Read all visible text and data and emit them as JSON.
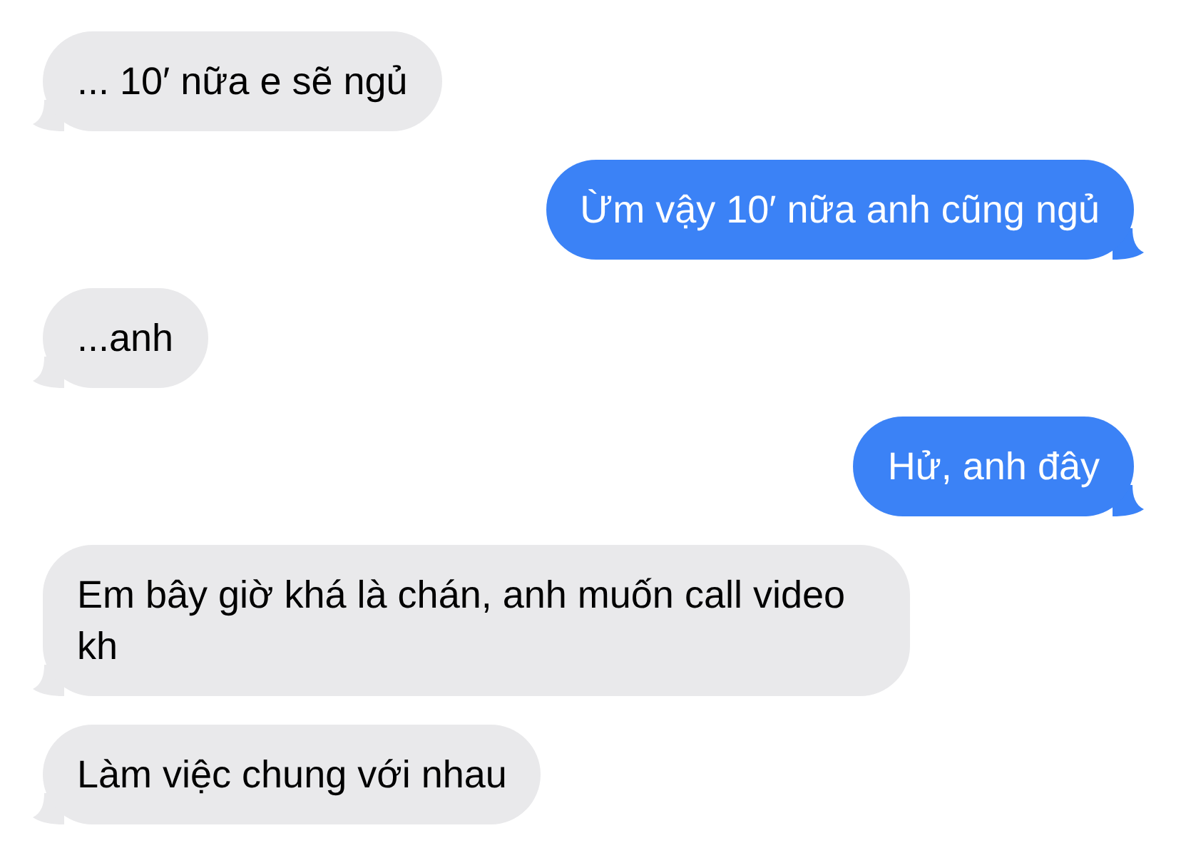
{
  "messages": [
    {
      "kind": "received",
      "text": "... 10′ nữa e sẽ ngủ"
    },
    {
      "kind": "sent",
      "text": "Ừm vậy 10′ nữa anh cũng ngủ"
    },
    {
      "kind": "received",
      "text": "...anh"
    },
    {
      "kind": "sent",
      "text": "Hử, anh đây"
    },
    {
      "kind": "received",
      "text": "Em bây giờ khá là chán, anh muốn call video kh"
    },
    {
      "kind": "received",
      "text": "Làm việc chung với nhau"
    }
  ]
}
